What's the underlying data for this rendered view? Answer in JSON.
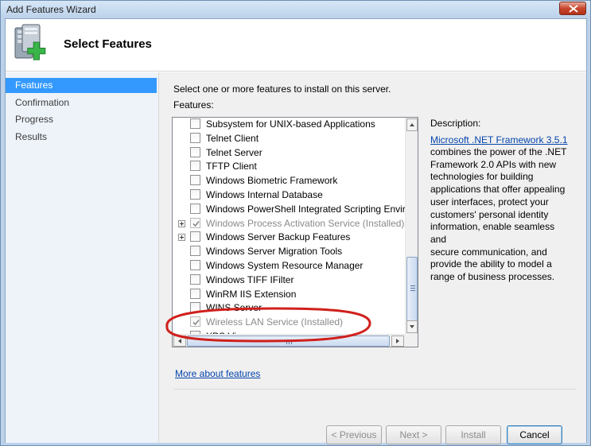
{
  "window": {
    "title": "Add Features Wizard",
    "header_title": "Select Features"
  },
  "nav": {
    "items": [
      {
        "label": "Features",
        "active": true
      },
      {
        "label": "Confirmation",
        "active": false
      },
      {
        "label": "Progress",
        "active": false
      },
      {
        "label": "Results",
        "active": false
      }
    ]
  },
  "main": {
    "intro": "Select one or more features to install on this server.",
    "features_label": "Features:",
    "features": [
      {
        "label": "Subsystem for UNIX-based Applications",
        "checked": false,
        "disabled": false,
        "expandable": false
      },
      {
        "label": "Telnet Client",
        "checked": false,
        "disabled": false,
        "expandable": false
      },
      {
        "label": "Telnet Server",
        "checked": false,
        "disabled": false,
        "expandable": false
      },
      {
        "label": "TFTP Client",
        "checked": false,
        "disabled": false,
        "expandable": false
      },
      {
        "label": "Windows Biometric Framework",
        "checked": false,
        "disabled": false,
        "expandable": false
      },
      {
        "label": "Windows Internal Database",
        "checked": false,
        "disabled": false,
        "expandable": false
      },
      {
        "label": "Windows PowerShell Integrated Scripting Environment",
        "checked": false,
        "disabled": false,
        "expandable": false
      },
      {
        "label": "Windows Process Activation Service  (Installed)",
        "checked": true,
        "disabled": true,
        "expandable": true
      },
      {
        "label": "Windows Server Backup Features",
        "checked": false,
        "disabled": false,
        "expandable": true
      },
      {
        "label": "Windows Server Migration Tools",
        "checked": false,
        "disabled": false,
        "expandable": false
      },
      {
        "label": "Windows System Resource Manager",
        "checked": false,
        "disabled": false,
        "expandable": false
      },
      {
        "label": "Windows TIFF IFilter",
        "checked": false,
        "disabled": false,
        "expandable": false
      },
      {
        "label": "WinRM IIS Extension",
        "checked": false,
        "disabled": false,
        "expandable": false
      },
      {
        "label": "WINS Server",
        "checked": false,
        "disabled": false,
        "expandable": false
      },
      {
        "label": "Wireless LAN Service  (Installed)",
        "checked": true,
        "disabled": true,
        "expandable": false
      },
      {
        "label": "XPS Viewer",
        "checked": false,
        "disabled": false,
        "expandable": false
      }
    ],
    "description_label": "Description:",
    "description_link": "Microsoft .NET Framework 3.5.1",
    "description_lines": [
      "combines the power of the .NET",
      "Framework 2.0 APIs with new",
      "technologies for building",
      "applications that offer appealing",
      "user interfaces, protect your",
      "customers' personal identity",
      "information, enable seamless and",
      "secure communication, and",
      "provide the ability to model a",
      "range of business processes."
    ],
    "more_link": "More about features"
  },
  "buttons": {
    "previous": "< Previous",
    "next": "Next >",
    "install": "Install",
    "cancel": "Cancel"
  },
  "icons": {
    "header": "server-add-feature-icon",
    "close": "close-icon"
  },
  "colors": {
    "nav_active": "#3399ff",
    "link": "#0645ad",
    "annotation": "#d0201c"
  }
}
